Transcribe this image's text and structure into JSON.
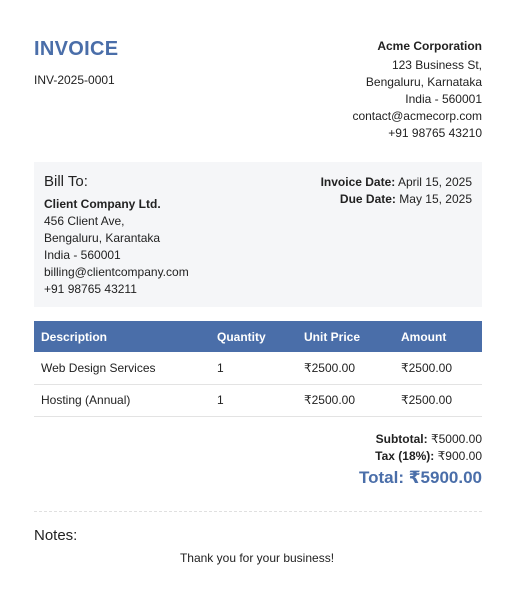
{
  "header": {
    "title": "INVOICE",
    "invoice_number": "INV-2025-0001"
  },
  "company": {
    "name": "Acme Corporation",
    "address_line1": "123 Business St,",
    "address_line2": "Bengaluru, Karnataka",
    "address_line3": "India - 560001",
    "email": "contact@acmecorp.com",
    "phone": "+91 98765 43210"
  },
  "bill_to": {
    "label": "Bill To:",
    "client_name": "Client Company Ltd.",
    "address_line1": "456 Client Ave,",
    "address_line2": "Bengaluru, Karantaka",
    "address_line3": "India - 560001",
    "email": "billing@clientcompany.com",
    "phone": "+91 98765 43211"
  },
  "dates": {
    "invoice_date_label": "Invoice Date:",
    "invoice_date": "April 15, 2025",
    "due_date_label": "Due Date:",
    "due_date": "May 15, 2025"
  },
  "table": {
    "headers": [
      "Description",
      "Quantity",
      "Unit Price",
      "Amount"
    ],
    "rows": [
      [
        "Web Design Services",
        "1",
        "₹2500.00",
        "₹2500.00"
      ],
      [
        "Hosting (Annual)",
        "1",
        "₹2500.00",
        "₹2500.00"
      ]
    ]
  },
  "totals": {
    "subtotal_label": "Subtotal:",
    "subtotal": "₹5000.00",
    "tax_label": "Tax (18%):",
    "tax": "₹900.00",
    "total_label": "Total:",
    "total": "₹5900.00"
  },
  "notes": {
    "label": "Notes:",
    "message": "Thank you for your business!"
  },
  "colors": {
    "accent": "#4a6ea9",
    "panel_bg": "#f5f6f8"
  }
}
